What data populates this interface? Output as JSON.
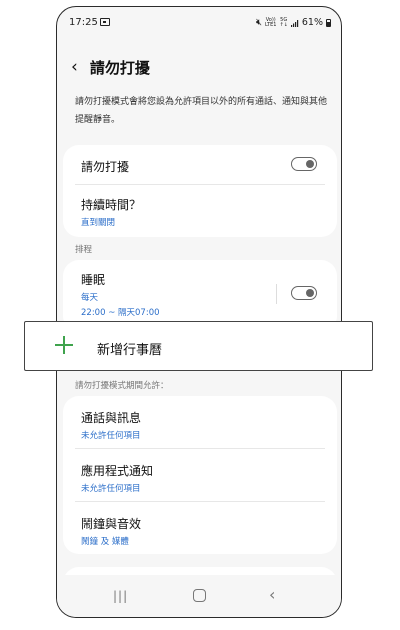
{
  "status_bar": {
    "time": "17:25",
    "network_top": "Vo))",
    "network_bottom": "LTE1",
    "gen_top": "5G",
    "gen_bottom": "↑↓",
    "battery": "61%"
  },
  "header": {
    "title": "請勿打擾"
  },
  "description": "請勿打擾模式會將您設為允許項目以外的所有通話、通知與其他提醒靜音。",
  "main_card": {
    "dnd_label": "請勿打擾",
    "dnd_enabled": false,
    "duration_label": "持續時間？",
    "duration_value": "直到關閉"
  },
  "schedule": {
    "section_label": "排程",
    "sleep_label": "睡眠",
    "sleep_days": "每天",
    "sleep_time": "22:00 ~ 隔天07:00",
    "sleep_enabled": false
  },
  "add_popup": {
    "label": "新增行事曆"
  },
  "allowed": {
    "section_label": "請勿打擾模式期間允許：",
    "items": [
      {
        "title": "通話與訊息",
        "sub": "未允許任何項目"
      },
      {
        "title": "應用程式通知",
        "sub": "未允許任何項目"
      },
      {
        "title": "鬧鐘與音效",
        "sub": "鬧鐘 及 媒體"
      }
    ]
  },
  "colors": {
    "accent_blue": "#2b6ec9",
    "plus_green": "#3fa34d",
    "background": "#f6f6f6"
  },
  "icons": {
    "back": "chevron-left-icon",
    "add": "plus-icon",
    "nav_recent": "recent-apps-icon",
    "nav_home": "home-icon",
    "nav_back": "back-nav-icon"
  }
}
